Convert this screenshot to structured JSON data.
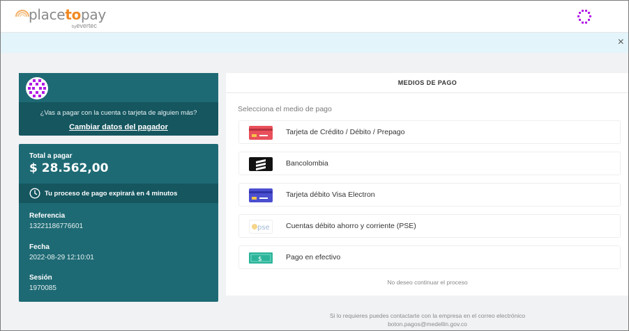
{
  "brand": {
    "name_prefix": "place",
    "name_accent": "to",
    "name_suffix": "pay",
    "by": "by",
    "company": "evertec"
  },
  "alert": {
    "close_icon": "×"
  },
  "payer": {
    "question": "¿Vas a pagar con la cuenta o tarjeta de alguien más?",
    "change_link": "Cambiar datos del pagador"
  },
  "summary": {
    "total_label": "Total a pagar",
    "total_amount": "$ 28.562,00",
    "timer_text": "Tu proceso de pago expirará en 4 minutos",
    "reference_label": "Referencia",
    "reference_value": "13221186776601",
    "date_label": "Fecha",
    "date_value": "2022-08-29 12:10:01",
    "session_label": "Sesión",
    "session_value": "1970085"
  },
  "methods": {
    "title": "MEDIOS DE PAGO",
    "subtitle": "Selecciona el medio de pago",
    "items": [
      {
        "label": "Tarjeta de Crédito / Débito / Prepago",
        "icon": "credit-card-icon"
      },
      {
        "label": "Bancolombia",
        "icon": "bancolombia-icon"
      },
      {
        "label": "Tarjeta débito Visa Electron",
        "icon": "visa-electron-card-icon"
      },
      {
        "label": "Cuentas débito ahorro y corriente (PSE)",
        "icon": "pse-icon",
        "icon_text": "pse"
      },
      {
        "label": "Pago en efectivo",
        "icon": "cash-icon",
        "icon_text": "$"
      }
    ],
    "cancel": "No deseo continuar el proceso"
  },
  "footer": {
    "line1": "Si lo requieres puedes contactarte con la empresa en el correo electrónico",
    "line2": "boton.pagos@medellin.gov.co"
  },
  "colors": {
    "primary_teal": "#1e6a74",
    "dark_teal": "#15565f",
    "brand_orange": "#f08a24",
    "alert_bg": "#e3f4fa",
    "badge_purple": "#b21ae6"
  }
}
